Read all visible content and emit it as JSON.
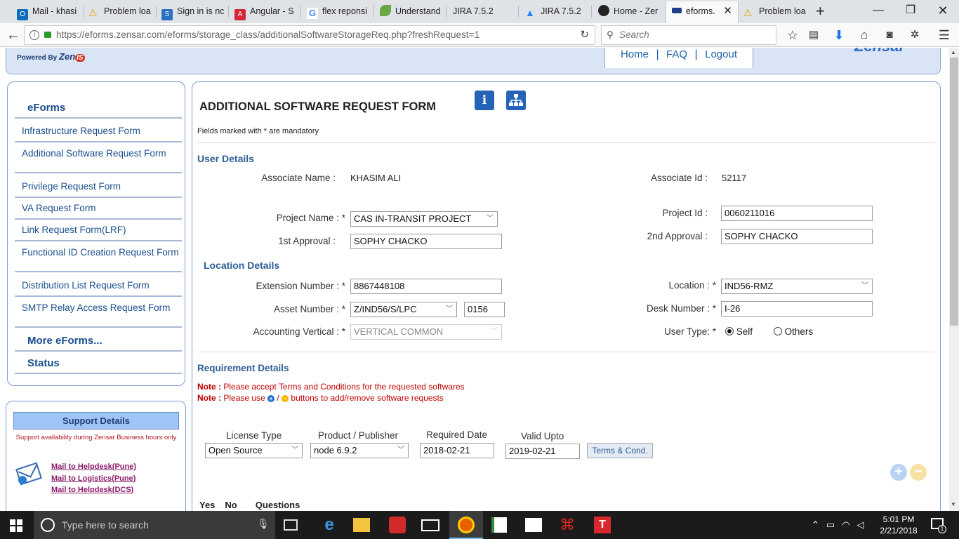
{
  "browser": {
    "tabs": [
      {
        "label": "Mail - khasi",
        "color": "#0f6cbd"
      },
      {
        "label": "Problem loa",
        "color": "#f2c12e"
      },
      {
        "label": "Sign in is nc",
        "color": "#2b6fc0"
      },
      {
        "label": "Angular - S",
        "color": "#d3283a"
      },
      {
        "label": "flex reponsi",
        "color": "#4285f4"
      },
      {
        "label": "Understand",
        "color": "#6ba644"
      },
      {
        "label": "JIRA 7.5.2",
        "color": ""
      },
      {
        "label": "JIRA 7.5.2",
        "color": "#2684ff"
      },
      {
        "label": "Home - Zer",
        "color": "#222222"
      },
      {
        "label": "eforms.",
        "color": "#1f3f8a"
      },
      {
        "label": "Problem loa",
        "color": "#f2c12e"
      }
    ],
    "url": "https://eforms.zensar.com/eforms/storage_class/additionalSoftwareStorageReq.php?freshRequest=1",
    "url_host": "eforms.zensar.com",
    "search_placeholder": "Search"
  },
  "header": {
    "powered_by": "Powered By",
    "brand": "Zen",
    "brand_suffix": "IS",
    "logo": "Zensar",
    "nav": [
      "Home",
      "FAQ",
      "Logout"
    ],
    "sep": "|"
  },
  "sidebar": {
    "title": "eForms",
    "items": [
      "Infrastructure Request Form",
      "Additional Software Request Form",
      "Privilege Request Form",
      "VA Request Form",
      "Link Request Form(LRF)",
      "Functional ID Creation Request Form",
      "Distribution List Request Form",
      "SMTP Relay Access Request Form"
    ],
    "more": "More eForms...",
    "status": "Status"
  },
  "support": {
    "title": "Support Details",
    "note": "Support availability during Zensar Business hours only",
    "links": [
      "Mail to Helpdesk(Pune)",
      "Mail to Logistics(Pune)",
      "Mail to Helpdesk(DCS)"
    ]
  },
  "form": {
    "title": "ADDITIONAL SOFTWARE REQUEST FORM",
    "mandatory_note": "Fields marked with * are mandatory",
    "user_details": "User Details",
    "associate_name_label": "Associate Name :",
    "associate_name": "KHASIM ALI",
    "associate_id_label": "Associate Id :",
    "associate_id": "52117",
    "project_name_label": "Project Name : *",
    "project_name": "CAS IN-TRANSIT PROJECT",
    "project_id_label": "Project Id :",
    "project_id": "0060211016",
    "approval1_label": "1st Approval :",
    "approval1": "SOPHY CHACKO",
    "approval2_label": "2nd Approval :",
    "approval2": "SOPHY CHACKO",
    "location_details": "Location Details",
    "ext_label": "Extension Number : *",
    "ext": "8867448108",
    "location_label": "Location : *",
    "location": "IND56-RMZ",
    "asset_label": "Asset Number : *",
    "asset_prefix": "Z/IND56/S/LPC",
    "asset_num": "0156",
    "desk_label": "Desk Number : *",
    "desk": "I-26",
    "vertical_label": "Accounting Vertical : *",
    "vertical": "VERTICAL COMMON",
    "usertype_label": "User Type: *",
    "usertype_self": "Self",
    "usertype_others": "Others",
    "requirement_details": "Requirement Details",
    "note_label": "Note :",
    "note1": "Please accept Terms and Conditions for the requested softwares",
    "note2_pre": "Please use",
    "note2_post": "buttons to add/remove software requests",
    "col_license": "License Type",
    "col_product": "Product / Publisher",
    "col_required": "Required Date",
    "col_valid": "Valid Upto",
    "license": "Open Source",
    "product": "node 6.9.2",
    "required_date": "2018-02-21",
    "valid_upto": "2019-02-21",
    "terms_btn": "Terms & Cond.",
    "q_yes": "Yes",
    "q_no": "No",
    "q_questions": "Questions"
  },
  "taskbar": {
    "search_placeholder": "Type here to search",
    "time": "5:01 PM",
    "date": "2/21/2018",
    "notif_count": "1"
  }
}
